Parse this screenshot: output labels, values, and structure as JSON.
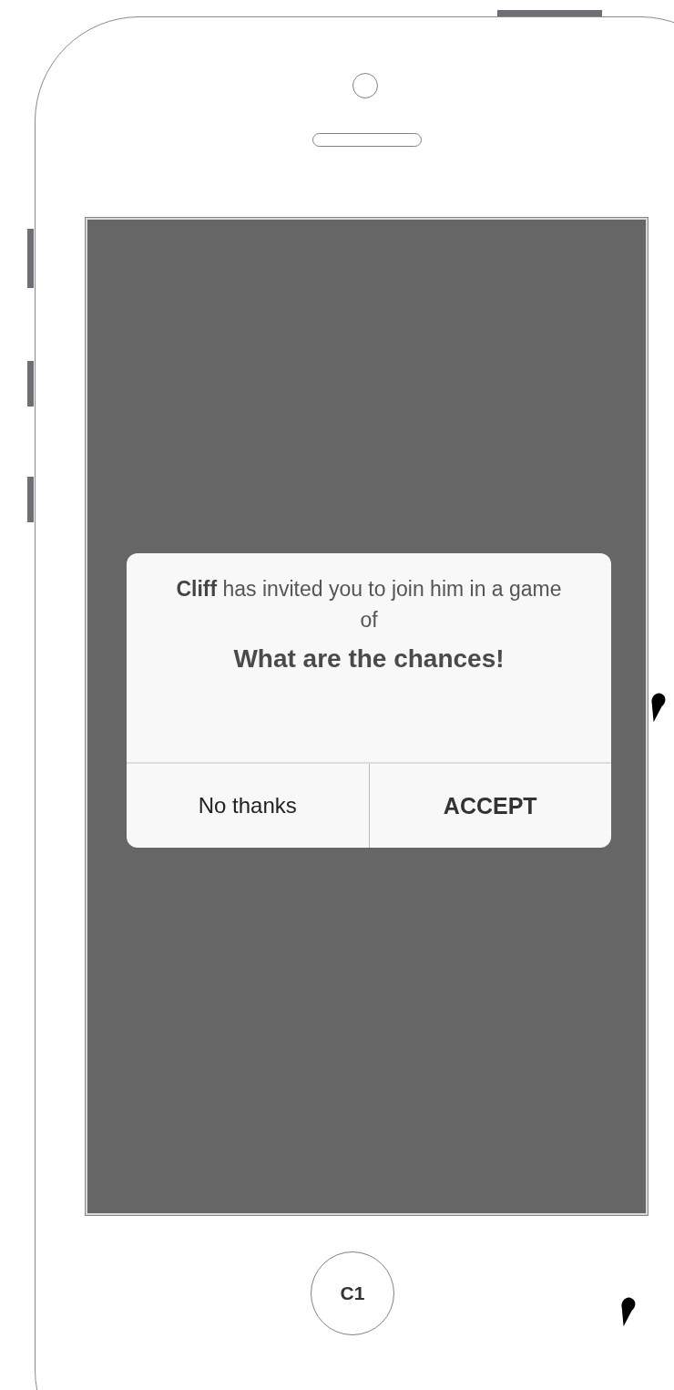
{
  "dialog": {
    "message": "**Cliff** has invited you to join him in a game of",
    "title": "What are the chances!",
    "buttons": [
      {
        "label": "No thanks",
        "kind": "secondary"
      },
      {
        "label": "ACCEPT",
        "kind": "primary"
      }
    ]
  },
  "home_button": {
    "label": "C1"
  }
}
